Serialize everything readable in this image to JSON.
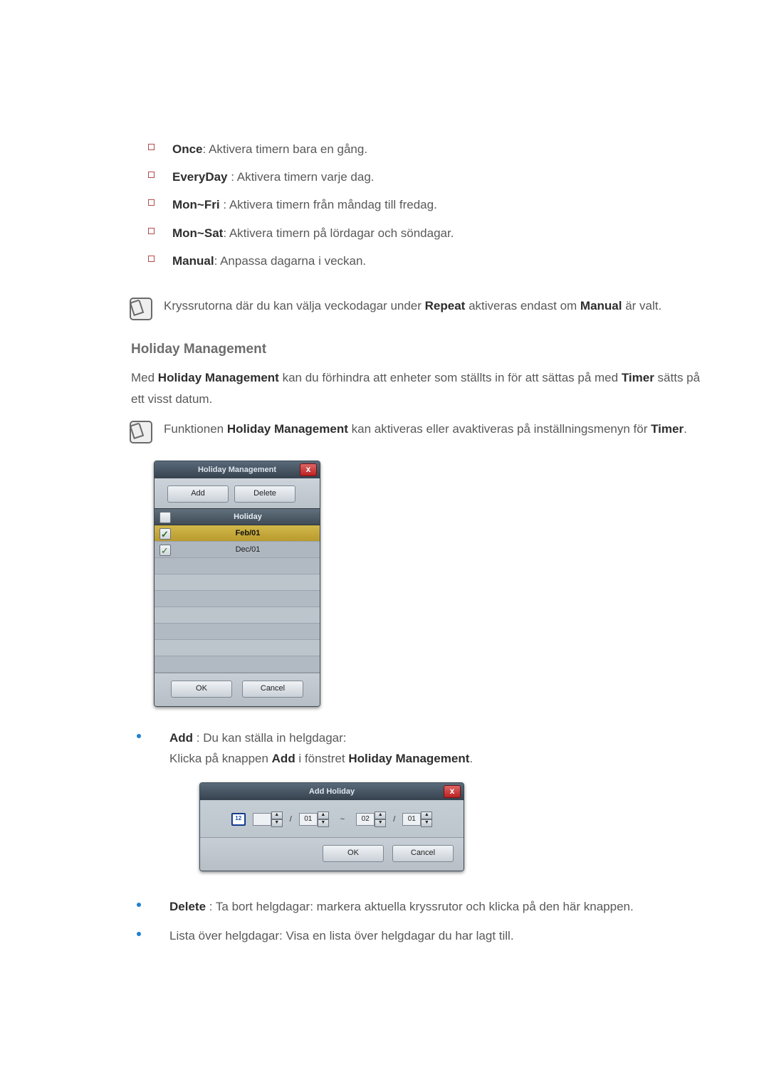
{
  "repeat_options": [
    {
      "name": "Once",
      "desc": ": Aktivera timern bara en gång."
    },
    {
      "name": "EveryDay",
      "desc": " : Aktivera timern varje dag."
    },
    {
      "name": "Mon~Fri",
      "desc": " : Aktivera timern från måndag till fredag."
    },
    {
      "name": "Mon~Sat",
      "desc": ": Aktivera timern på lördagar och söndagar."
    },
    {
      "name": "Manual",
      "desc": ": Anpassa dagarna i veckan."
    }
  ],
  "note1": {
    "pre": "Kryssrutorna där du kan välja veckodagar under ",
    "b1": "Repeat",
    "mid": " aktiveras endast om ",
    "b2": "Manual",
    "post": " är valt."
  },
  "holiday_section": {
    "title": "Holiday Management",
    "intro_pre": "Med ",
    "intro_b1": "Holiday Management",
    "intro_mid": " kan du förhindra att enheter som ställts in för att sättas på med ",
    "intro_b2": "Timer",
    "intro_post": " sätts på ett visst datum."
  },
  "note2": {
    "pre": "Funktionen ",
    "b1": "Holiday Management",
    "mid": " kan aktiveras eller avaktiveras på inställningsmenyn för ",
    "b2": "Timer",
    "post": "."
  },
  "hm_window": {
    "title": "Holiday Management",
    "close": "x",
    "add_btn": "Add",
    "delete_btn": "Delete",
    "col_holiday": "Holiday",
    "rows": [
      {
        "checked": true,
        "value": "Feb/01",
        "selected": true
      },
      {
        "checked": true,
        "value": "Dec/01",
        "selected": false
      }
    ],
    "ok_btn": "OK",
    "cancel_btn": "Cancel"
  },
  "bullets": {
    "add_name": "Add",
    "add_desc": " : Du kan ställa in helgdagar:",
    "add_line2_pre": "Klicka på knappen ",
    "add_line2_b1": "Add",
    "add_line2_mid": " i fönstret ",
    "add_line2_b2": "Holiday Management",
    "add_line2_post": ".",
    "delete_name": "Delete",
    "delete_desc": " : Ta bort helgdagar: markera aktuella kryssrutor och klicka på den här knappen.",
    "list_desc": "Lista över helgdagar: Visa en lista över helgdagar du har lagt till."
  },
  "add_window": {
    "title": "Add Holiday",
    "close": "x",
    "from_month": "",
    "from_day": "01",
    "to_month": "02",
    "to_day": "01",
    "ok_btn": "OK",
    "cancel_btn": "Cancel"
  }
}
